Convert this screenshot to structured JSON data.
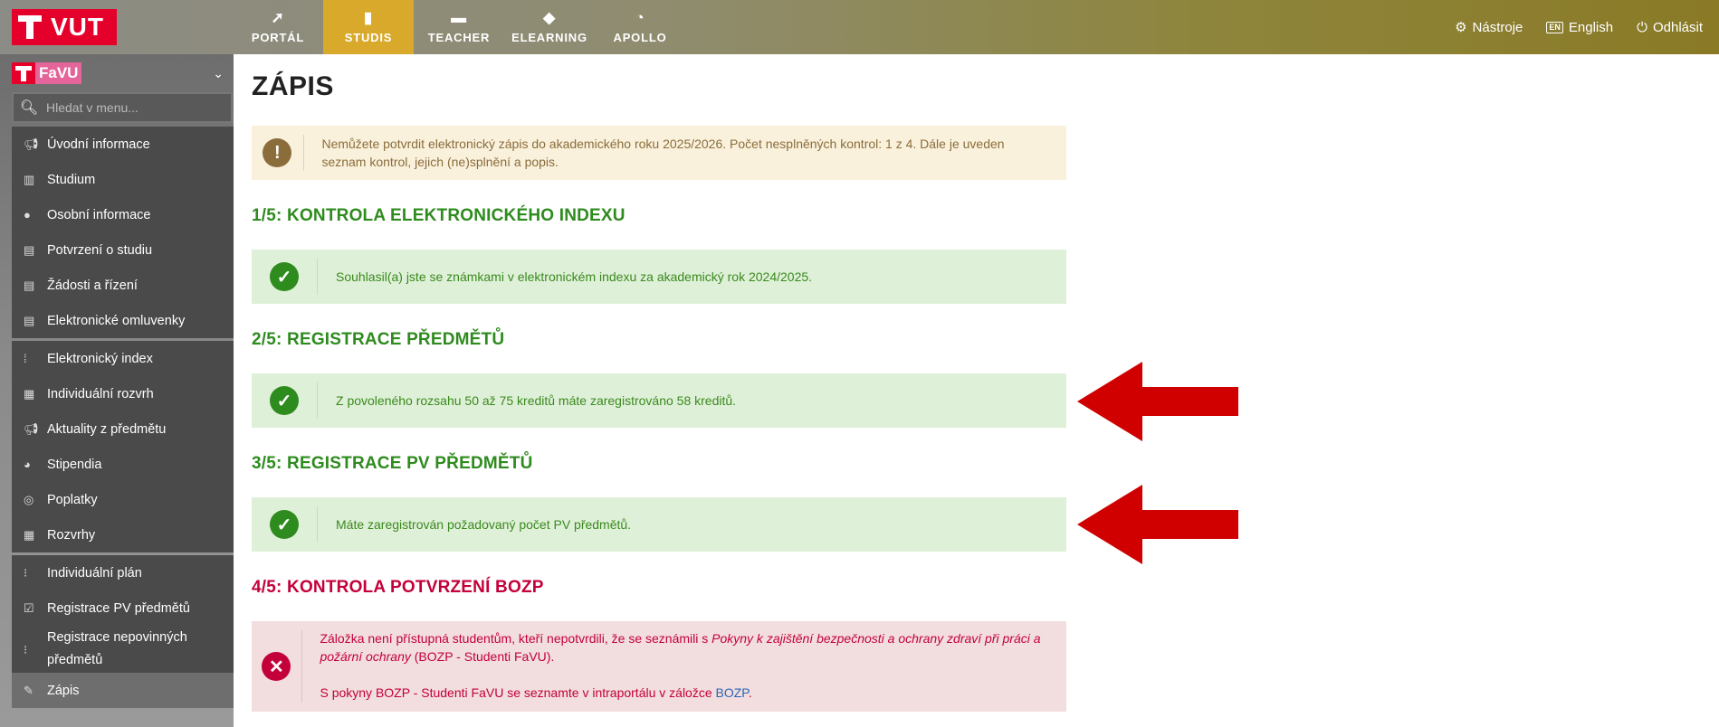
{
  "logo": {
    "text": "VUT"
  },
  "topnav": [
    {
      "label": "PORTÁL",
      "icon": "navigation-arrow-icon",
      "active": false
    },
    {
      "label": "STUDIS",
      "icon": "book-icon",
      "active": true
    },
    {
      "label": "TEACHER",
      "icon": "briefcase-icon",
      "active": false
    },
    {
      "label": "ELEARNING",
      "icon": "graduation-cap-icon",
      "active": false
    },
    {
      "label": "APOLLO",
      "icon": "flame-icon",
      "active": false
    }
  ],
  "topright": {
    "tools": "Nástroje",
    "language": "English",
    "language_badge": "EN",
    "logout": "Odhlásit"
  },
  "sidebar": {
    "faculty": "FaVU",
    "search_placeholder": "Hledat v menu...",
    "groups": [
      [
        {
          "label": "Úvodní informace",
          "icon": "megaphone-icon"
        },
        {
          "label": "Studium",
          "icon": "books-icon"
        },
        {
          "label": "Osobní informace",
          "icon": "user-icon"
        },
        {
          "label": "Potvrzení o studiu",
          "icon": "documents-icon"
        },
        {
          "label": "Žádosti a řízení",
          "icon": "documents-icon"
        },
        {
          "label": "Elektronické omluvenky",
          "icon": "documents-icon"
        }
      ],
      [
        {
          "label": "Elektronický index",
          "icon": "index-icon"
        },
        {
          "label": "Individuální rozvrh",
          "icon": "calendar-icon"
        },
        {
          "label": "Aktuality z předmětu",
          "icon": "megaphone-icon"
        },
        {
          "label": "Stipendia",
          "icon": "piggy-bank-icon"
        },
        {
          "label": "Poplatky",
          "icon": "coins-icon"
        },
        {
          "label": "Rozvrhy",
          "icon": "calendar-icon"
        }
      ],
      [
        {
          "label": "Individuální plán",
          "icon": "plan-icon"
        },
        {
          "label": "Registrace PV předmětů",
          "icon": "clipboard-check-icon"
        },
        {
          "label": "Registrace nepovinných předmětů",
          "icon": "plan-icon"
        },
        {
          "label": "Zápis",
          "icon": "pencil-icon",
          "active": true
        }
      ]
    ]
  },
  "main": {
    "title": "ZÁPIS",
    "warning": "Nemůžete potvrdit elektronický zápis do akademického roku 2025/2026. Počet nesplněných kontrol: 1 z 4. Dále je uveden seznam kontrol, jejich (ne)splnění a popis.",
    "sections": [
      {
        "heading": "1/5: KONTROLA ELEKTRONICKÉHO INDEXU",
        "status": "ok",
        "text": "Souhlasil(a) jste se známkami v elektronickém indexu za akademický rok 2024/2025."
      },
      {
        "heading": "2/5: REGISTRACE PŘEDMĚTŮ",
        "status": "ok",
        "text": "Z povoleného rozsahu 50 až 75 kreditů máte zaregistrováno 58 kreditů."
      },
      {
        "heading": "3/5: REGISTRACE PV PŘEDMĚTŮ",
        "status": "ok",
        "text": "Máte zaregistrován požadovaný počet PV předmětů."
      },
      {
        "heading": "4/5: KONTROLA POTVRZENÍ BOZP",
        "status": "error",
        "text_before": "Záložka není přístupná studentům, kteří nepotvrdili, že se seznámili s ",
        "text_italic": "Pokyny k zajištění bezpečnosti a ochrany zdraví při práci a požární ochrany",
        "text_after": " (BOZP - Studenti FaVU).",
        "text2_before": "S pokyny BOZP - Studenti FaVU se seznamte v intraportálu v záložce ",
        "text2_link": "BOZP",
        "text2_after": "."
      }
    ]
  },
  "colors": {
    "accent_yellow": "#d8a92a",
    "brand_red": "#e4002b",
    "ok_green": "#2e8b1e",
    "error_red": "#c4003a",
    "arrow_red": "#d10000"
  }
}
